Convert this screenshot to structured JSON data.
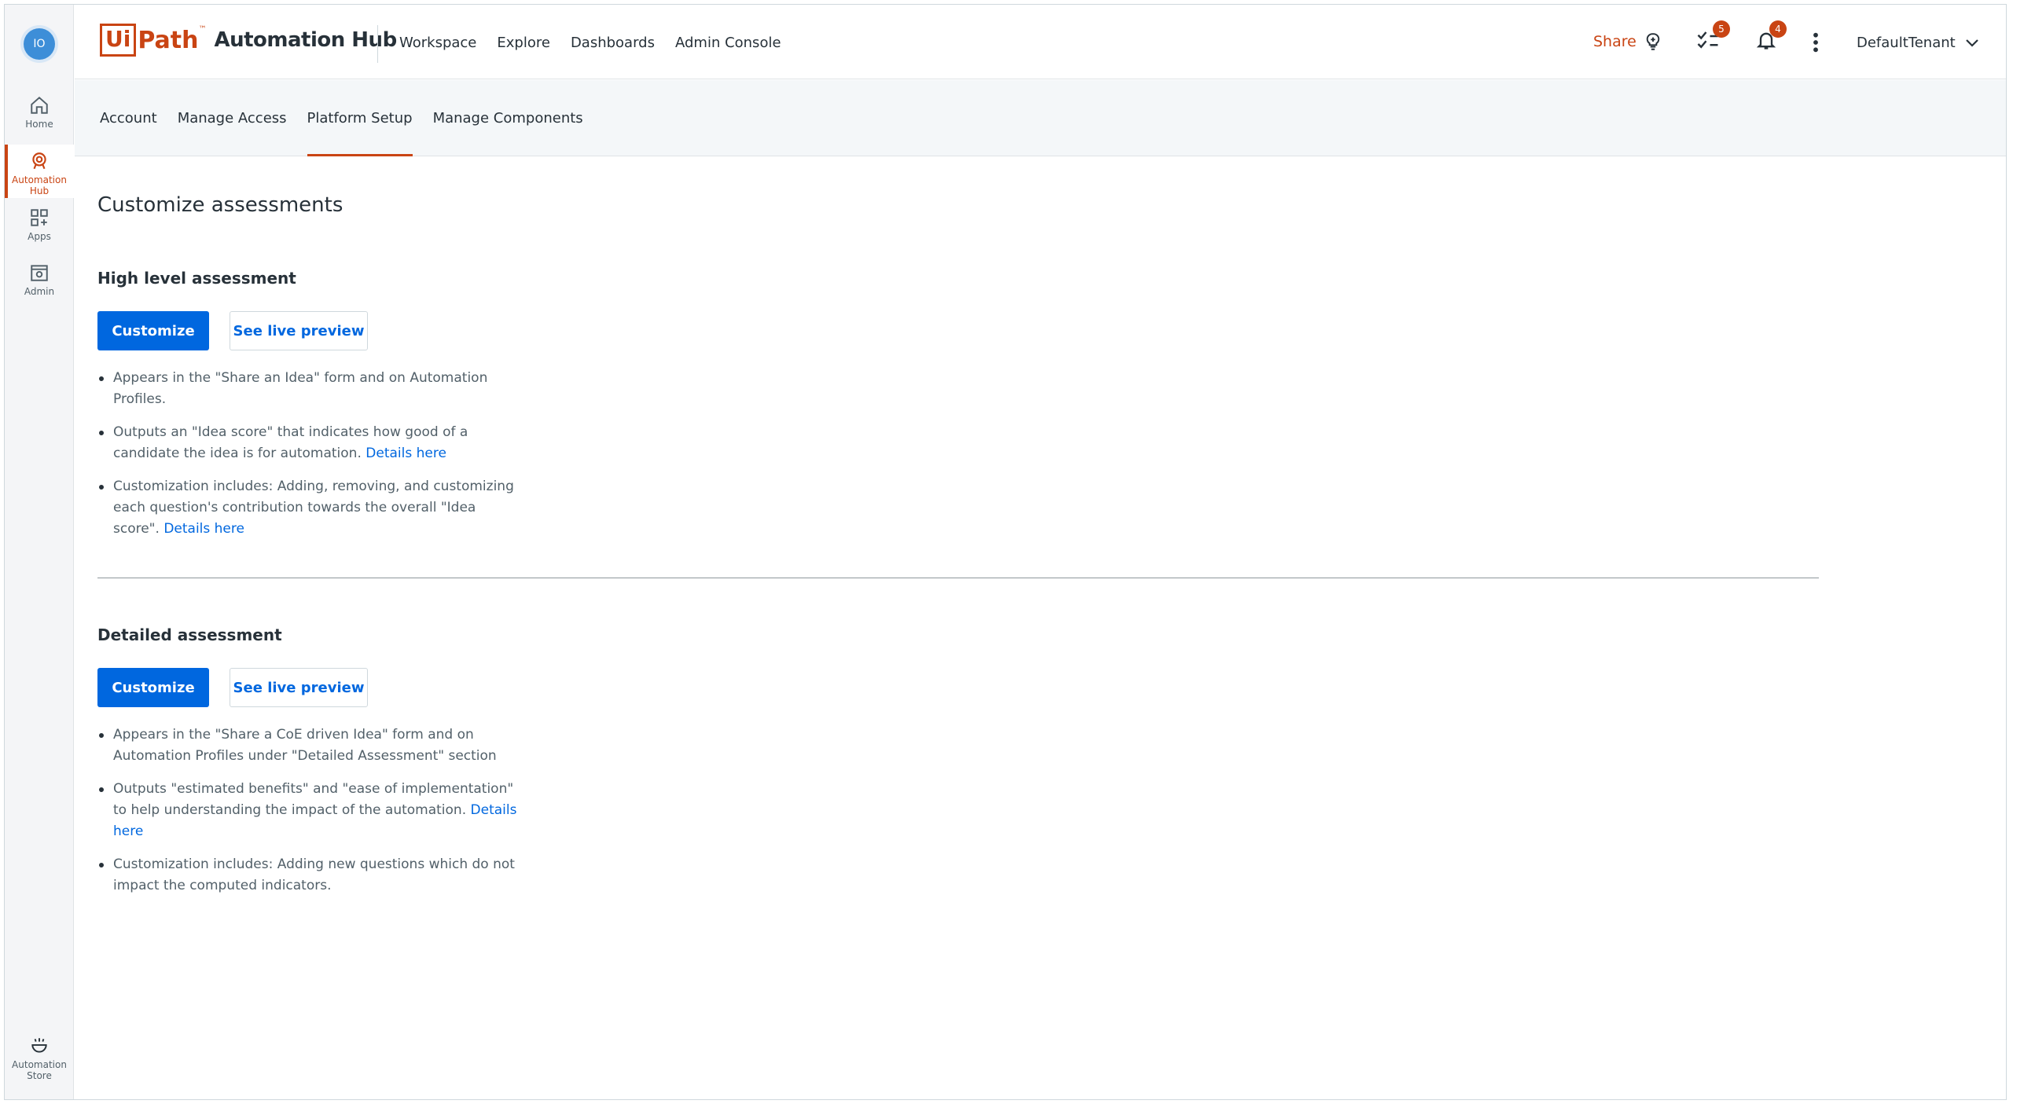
{
  "rail": {
    "avatar_initials": "IO",
    "items": [
      {
        "label": "Home",
        "icon": "home-icon"
      },
      {
        "label": "Automation Hub",
        "icon": "automation-hub-icon"
      },
      {
        "label": "Apps",
        "icon": "apps-icon"
      },
      {
        "label": "Admin",
        "icon": "admin-icon"
      },
      {
        "label": "Automation Store",
        "icon": "automation-store-icon"
      }
    ]
  },
  "header": {
    "logo_ui": "Ui",
    "logo_path": "Path",
    "logo_tm": "™",
    "product": "Automation Hub",
    "nav": [
      "Workspace",
      "Explore",
      "Dashboards",
      "Admin Console"
    ],
    "share_label": "Share",
    "tasks_badge": "5",
    "notifications_badge": "4",
    "tenant": "DefaultTenant"
  },
  "subnav": {
    "tabs": [
      "Account",
      "Manage Access",
      "Platform Setup",
      "Manage Components"
    ],
    "active": "Platform Setup"
  },
  "main": {
    "title": "Customize assessments",
    "high_level": {
      "title": "High level assessment",
      "customize_label": "Customize",
      "preview_label": "See live preview",
      "bullet1": "Appears in the \"Share an Idea\" form and on Automation Profiles.",
      "bullet2_text": "Outputs an \"Idea score\" that indicates how good of a candidate the idea is for automation.",
      "bullet2_link": "Details here",
      "bullet3_text": "Customization includes: Adding, removing, and customizing each question's contribution towards the overall \"Idea score\".",
      "bullet3_link": "Details here"
    },
    "detailed": {
      "title": "Detailed assessment",
      "customize_label": "Customize",
      "preview_label": "See live preview",
      "bullet1": "Appears in the \"Share a CoE driven Idea\" form and on Automation Profiles under \"Detailed Assessment\" section",
      "bullet2_text": "Outputs \"estimated benefits\" and \"ease of implementation\" to help understanding the impact of the automation.",
      "bullet2_link": "Details here",
      "bullet3": "Customization includes: Adding new questions which do not impact the computed indicators."
    }
  },
  "colors": {
    "brand": "#c94413",
    "primary": "#0067df",
    "text": "#273139"
  }
}
